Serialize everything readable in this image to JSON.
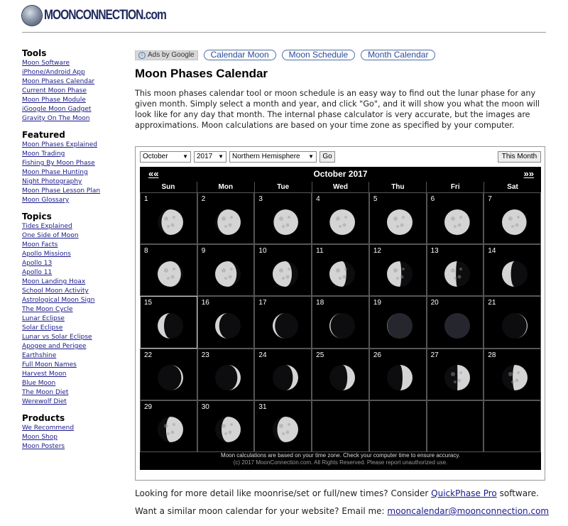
{
  "header": {
    "logo_main": "MOONCONNECTION",
    "logo_suffix": ".com"
  },
  "sidebar": [
    {
      "title": "Tools",
      "items": [
        "Moon Software",
        "iPhone/Android App",
        "Moon Phases Calendar",
        "Current Moon Phase",
        "Moon Phase Module",
        "iGoogle Moon Gadget",
        "Gravity On The Moon"
      ]
    },
    {
      "title": "Featured",
      "items": [
        "Moon Phases Explained",
        "Moon Trading",
        "Fishing By Moon Phase",
        "Moon Phase Hunting",
        "Night Photography",
        "Moon Phase Lesson Plan",
        "Moon Glossary"
      ]
    },
    {
      "title": "Topics",
      "items": [
        "Tides Explained",
        "One Side of Moon",
        "Moon Facts",
        "Apollo Missions",
        "Apollo 13",
        "Apollo 11",
        "Moon Landing Hoax",
        "School Moon Activity",
        "Astrological Moon Sign",
        "The Moon Cycle",
        "Lunar Eclipse",
        "Solar Eclipse",
        "Lunar vs Solar Eclipse",
        "Apogee and Perigee",
        "Earthshine",
        "Full Moon Names",
        "Harvest Moon",
        "Blue Moon",
        "The Moon Diet",
        "Werewolf Diet"
      ]
    },
    {
      "title": "Products",
      "items": [
        "We Recommend",
        "Moon Shop",
        "Moon Posters"
      ]
    }
  ],
  "topnav": {
    "ads_label": "Ads by Google",
    "links": [
      "Calendar Moon",
      "Moon Schedule",
      "Month Calendar"
    ]
  },
  "page_title": "Moon Phases Calendar",
  "intro": "This moon phases calendar tool or moon schedule is an easy way to find out the lunar phase for any given month. Simply select a month and year, and click \"Go\", and it will show you what the moon will look like for any day that month. The internal phase calculator is very accurate, but the images are approximations. Moon calculations are based on your time zone as specified by your computer.",
  "controls": {
    "month": "October",
    "year": "2017",
    "hemisphere": "Northern Hemisphere",
    "go_label": "Go",
    "this_month_label": "This Month"
  },
  "calendar": {
    "title": "October 2017",
    "prev_label": "««",
    "next_label": "»»",
    "weekdays": [
      "Sun",
      "Mon",
      "Tue",
      "Wed",
      "Thu",
      "Fri",
      "Sat"
    ],
    "first_weekday": 0,
    "today": 15,
    "days": [
      {
        "d": 1,
        "illum": 0.85,
        "waxing": true
      },
      {
        "d": 2,
        "illum": 0.91,
        "waxing": true
      },
      {
        "d": 3,
        "illum": 0.96,
        "waxing": true
      },
      {
        "d": 4,
        "illum": 0.99,
        "waxing": true
      },
      {
        "d": 5,
        "illum": 1.0,
        "waxing": true
      },
      {
        "d": 6,
        "illum": 0.99,
        "waxing": false
      },
      {
        "d": 7,
        "illum": 0.96,
        "waxing": false
      },
      {
        "d": 8,
        "illum": 0.91,
        "waxing": false
      },
      {
        "d": 9,
        "illum": 0.84,
        "waxing": false
      },
      {
        "d": 10,
        "illum": 0.75,
        "waxing": false
      },
      {
        "d": 11,
        "illum": 0.66,
        "waxing": false
      },
      {
        "d": 12,
        "illum": 0.56,
        "waxing": false
      },
      {
        "d": 13,
        "illum": 0.45,
        "waxing": false
      },
      {
        "d": 14,
        "illum": 0.35,
        "waxing": false
      },
      {
        "d": 15,
        "illum": 0.25,
        "waxing": false
      },
      {
        "d": 16,
        "illum": 0.16,
        "waxing": false
      },
      {
        "d": 17,
        "illum": 0.09,
        "waxing": false
      },
      {
        "d": 18,
        "illum": 0.04,
        "waxing": false
      },
      {
        "d": 19,
        "illum": 0.01,
        "waxing": false
      },
      {
        "d": 20,
        "illum": 0.0,
        "waxing": true
      },
      {
        "d": 21,
        "illum": 0.03,
        "waxing": true
      },
      {
        "d": 22,
        "illum": 0.07,
        "waxing": true
      },
      {
        "d": 23,
        "illum": 0.13,
        "waxing": true
      },
      {
        "d": 24,
        "illum": 0.21,
        "waxing": true
      },
      {
        "d": 25,
        "illum": 0.3,
        "waxing": true
      },
      {
        "d": 26,
        "illum": 0.39,
        "waxing": true
      },
      {
        "d": 27,
        "illum": 0.49,
        "waxing": true
      },
      {
        "d": 28,
        "illum": 0.58,
        "waxing": true
      },
      {
        "d": 29,
        "illum": 0.67,
        "waxing": true
      },
      {
        "d": 30,
        "illum": 0.75,
        "waxing": true
      },
      {
        "d": 31,
        "illum": 0.82,
        "waxing": true
      }
    ],
    "footer_line1": "Moon calculations are based on your time zone. Check your computer time to ensure accuracy.",
    "footer_line2": "(c) 2017 MoonConnection.com. All Rights Reserved. Please report unauthorized use."
  },
  "after": {
    "line1_prefix": "Looking for more detail like moonrise/set or full/new times? Consider ",
    "line1_link": "QuickPhase Pro",
    "line1_suffix": " software.",
    "line2_prefix": "Want a similar moon calendar for your website? Email me: ",
    "line2_link": "mooncalendar@moonconnection.com"
  },
  "colors": {
    "link": "#1a1a8a",
    "calendar_bg": "#000000",
    "moon_lit": "#d4d4d4",
    "moon_dark": "#26262e"
  }
}
